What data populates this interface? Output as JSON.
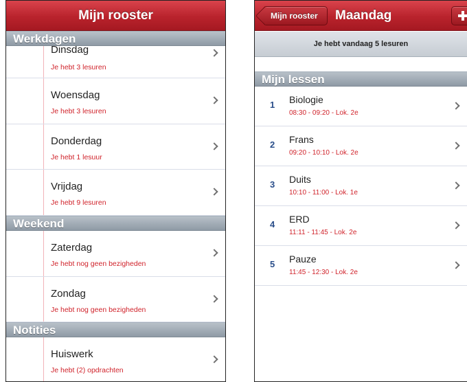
{
  "left_screen": {
    "title": "Mijn rooster",
    "sections": {
      "werkdagen": "Werkdagen",
      "weekend": "Weekend",
      "notities": "Notities"
    },
    "rows": [
      {
        "title": "Dinsdag",
        "subtitle": "Je hebt 3 lesuren"
      },
      {
        "title": "Woensdag",
        "subtitle": "Je hebt 3 lesuren"
      },
      {
        "title": "Donderdag",
        "subtitle": "Je hebt 1 lesuur"
      },
      {
        "title": "Vrijdag",
        "subtitle": "Je hebt 9 lesuren"
      },
      {
        "title": "Zaterdag",
        "subtitle": "Je hebt nog geen bezigheden"
      },
      {
        "title": "Zondag",
        "subtitle": "Je hebt nog geen bezigheden"
      },
      {
        "title": "Huiswerk",
        "subtitle": "Je hebt (2) opdrachten"
      }
    ]
  },
  "right_screen": {
    "back_label": "Mijn rooster",
    "title": "Maandag",
    "add_icon": "plus-icon",
    "info": "Je hebt vandaag 5 lesuren",
    "section": "Mijn lessen",
    "lessons": [
      {
        "num": "1",
        "title": "Biologie",
        "subtitle": "08:30 - 09:20 - Lok. 2e"
      },
      {
        "num": "2",
        "title": "Frans",
        "subtitle": "09:20 - 10:10 - Lok. 2e"
      },
      {
        "num": "3",
        "title": "Duits",
        "subtitle": "10:10 - 11:00 - Lok. 1e"
      },
      {
        "num": "4",
        "title": "ERD",
        "subtitle": "11:11 - 11:45 - Lok. 2e"
      },
      {
        "num": "5",
        "title": "Pauze",
        "subtitle": "11:45 - 12:30 - Lok. 2e"
      }
    ]
  },
  "colors": {
    "navbar": "#b9232c",
    "subtitle_red": "#d0232b",
    "lesson_number_blue": "#2a4e8a",
    "section_grey": "#8f9aa5"
  }
}
